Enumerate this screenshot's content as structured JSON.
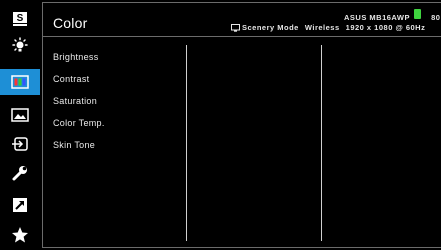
{
  "page": {
    "title": "Color"
  },
  "header": {
    "model": "ASUS MB16AWP",
    "level": "80",
    "mode": "Scenery Mode",
    "connection": "Wireless",
    "resolution": "1920 x 1080 @ 60Hz"
  },
  "sidebar": {
    "items": [
      {
        "icon": "splendid-icon",
        "active": false
      },
      {
        "icon": "blue-light-filter-icon",
        "active": false
      },
      {
        "icon": "color-icon",
        "active": true
      },
      {
        "icon": "image-icon",
        "active": false
      },
      {
        "icon": "input-select-icon",
        "active": false
      },
      {
        "icon": "system-setup-icon",
        "active": false
      },
      {
        "icon": "shortcut-icon",
        "active": false
      },
      {
        "icon": "myfavorite-icon",
        "active": false
      }
    ]
  },
  "menu": {
    "items": [
      "Brightness",
      "Contrast",
      "Saturation",
      "Color Temp.",
      "Skin Tone"
    ]
  },
  "colors": {
    "accent": "#1e8fd6",
    "battery": "#3fd43f",
    "background": "#000000"
  }
}
